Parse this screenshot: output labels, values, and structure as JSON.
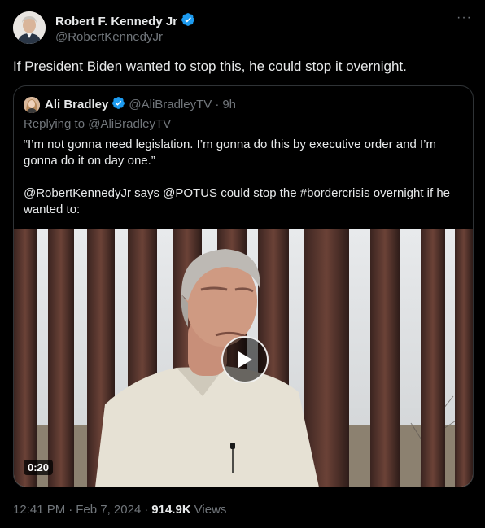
{
  "author": {
    "name": "Robert F. Kennedy Jr",
    "handle": "@RobertKennedyJr",
    "verified": true,
    "verified_color": "#1d9bf0"
  },
  "more_icon": "···",
  "tweet": {
    "text": "If President Biden wanted to stop this, he could stop it overnight."
  },
  "quote": {
    "name": "Ali Bradley",
    "handle": "@AliBradleyTV",
    "separator": "·",
    "time": "9h",
    "reply_to": "Replying to @AliBradleyTV",
    "paragraphs": [
      "“I’m not gonna need legislation. I’m gonna do this by executive order and I’m gonna do it on day one.”",
      "@RobertKennedyJr says @POTUS could stop the #bordercrisis overnight if he wanted to:"
    ],
    "video": {
      "duration": "0:20"
    }
  },
  "meta": {
    "time": "12:41 PM",
    "sep1": "·",
    "date": "Feb 7, 2024",
    "sep2": "·",
    "views_count": "914.9K",
    "views_label": "Views"
  }
}
